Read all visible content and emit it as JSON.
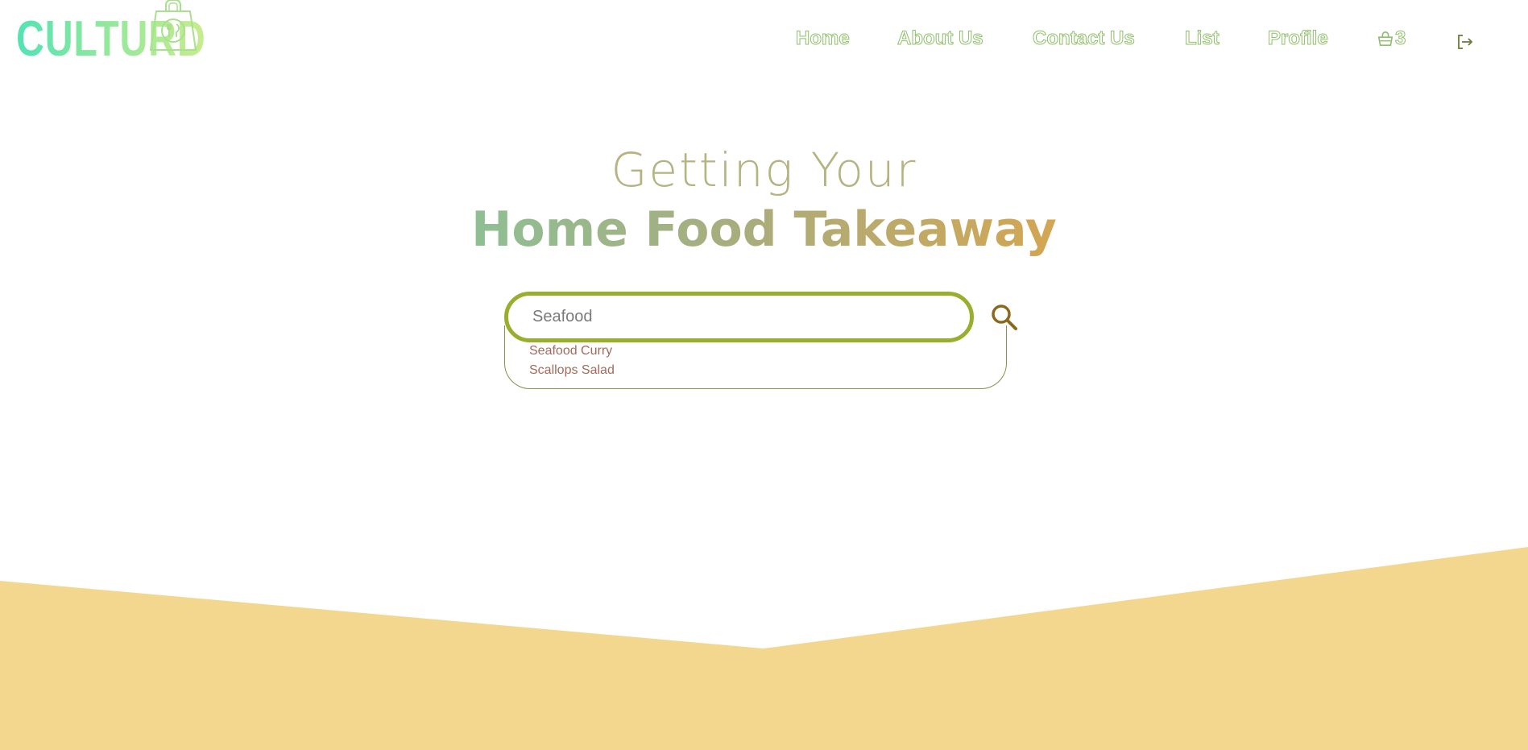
{
  "brand": {
    "name": "CULTURD",
    "logo_icon": "shopping-bag-with-cutlery-icon"
  },
  "nav": {
    "home": "Home",
    "about": "About Us",
    "contact": "Contact Us",
    "list": "List",
    "profile": "Profile",
    "cart_icon": "basket-icon",
    "cart_count": "3",
    "logout_icon": "logout-icon"
  },
  "hero": {
    "line1": "Getting Your",
    "line2": "Home Food Takeaway"
  },
  "search": {
    "value": "Seafood",
    "placeholder": "",
    "button_icon": "search-icon",
    "suggestions": [
      "Seafood Curry",
      "Scallops Salad"
    ]
  },
  "colors": {
    "accent_green": "#9aae2e",
    "nav_outline": "#8fbf6a",
    "suggestion_text": "#a26a5c",
    "wedge_fill": "#f3d78e",
    "search_icon": "#8a6a1a"
  }
}
